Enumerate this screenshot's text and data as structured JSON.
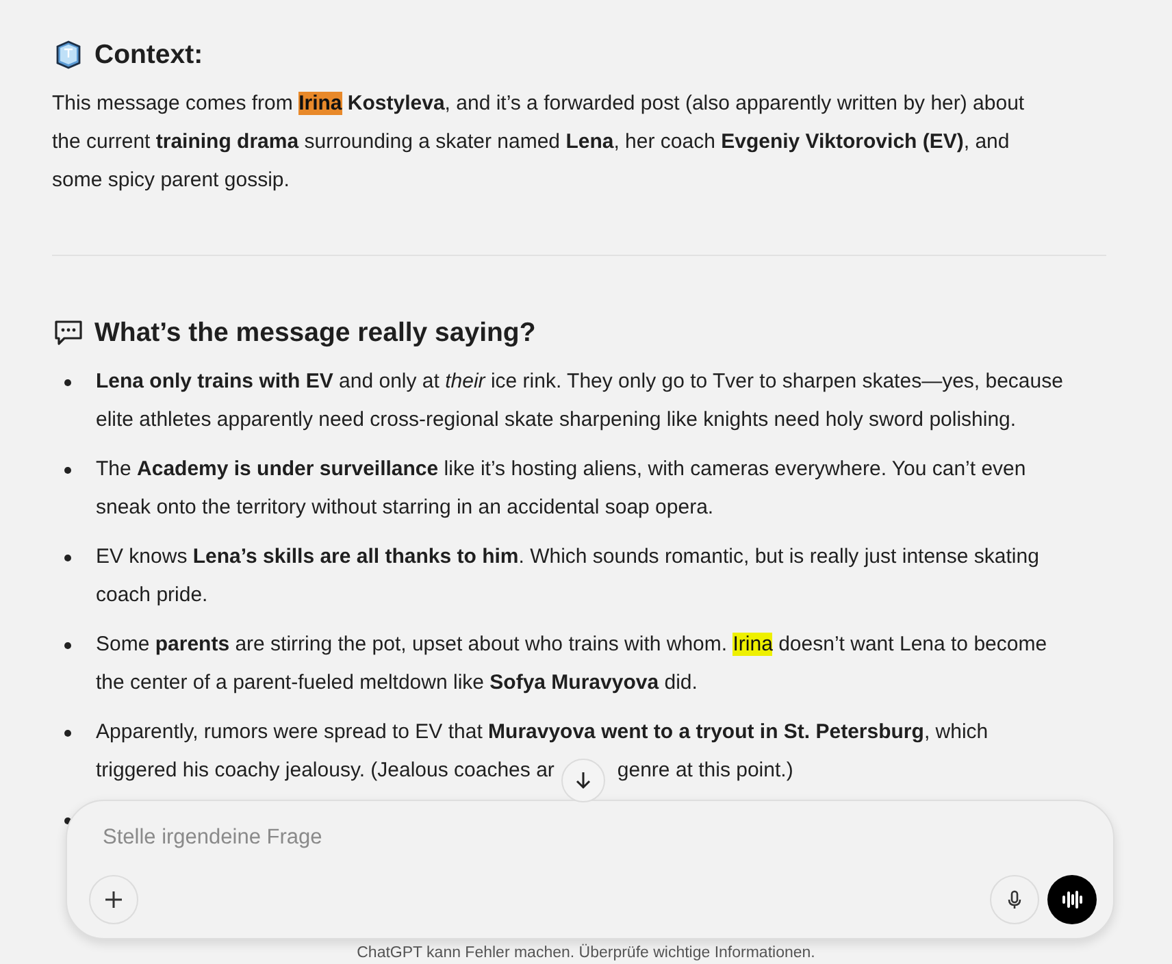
{
  "sections": [
    {
      "heading": "Context:",
      "paragraphs": [
        [
          {
            "text": "This message comes from "
          },
          {
            "text": "**Irina**",
            "color": "#e8892a"
          },
          {
            "text": " **Kostyleva**, and it’s a forwarded post (also apparently written by her) about the current **training drama** surrounding a skater named **Lena**, her coach **Evgeniy Viktorovich (EV)**, and some spicy parent gossip."
          }
        ]
      ]
    },
    {
      "heading": "What’s the message really saying?",
      "bullets": [
        {
          "parts": [
            {
              "text": "**Lena only trains with EV** and only at *their* ice rink. They only go to Tver to sharpen skates—yes, because elite athletes apparently need cross-regional skate sharpening like knights need holy sword polishing."
            }
          ]
        },
        {
          "parts": [
            {
              "text": "The **Academy is under surveillance** like it’s hosting aliens, with cameras everywhere. You can’t even sneak onto the territory without starring in an accidental soap opera."
            }
          ]
        },
        {
          "parts": [
            {
              "text": "EV knows **Lena’s skills are all thanks to him**. Which sounds romantic, but is really just intense skating coach pride."
            }
          ]
        },
        {
          "parts": [
            {
              "text": "Some **parents** are stirring the pot, upset about who trains with whom. "
            },
            {
              "text": "Irina",
              "color": "#eef000"
            },
            {
              "text": " doesn’t want Lena to become the center of a parent-fueled meltdown like **Sofya Muravyova** did."
            }
          ]
        },
        {
          "lines": [
            [
              "Apparently, rumors were spread to EV that **Muravyova went to a tryout in St. Petersburg**, which"
            ],
            [
              "triggered his coachy jealousy. (Jealous coaches ar",
              "genre at this point.)"
            ]
          ]
        }
      ],
      "partial_bullet": true
    }
  ],
  "composer": {
    "placeholder": "Stelle irgendeine Frage"
  },
  "footer": "ChatGPT kann Fehler machen. Überprüfe wichtige Informationen."
}
